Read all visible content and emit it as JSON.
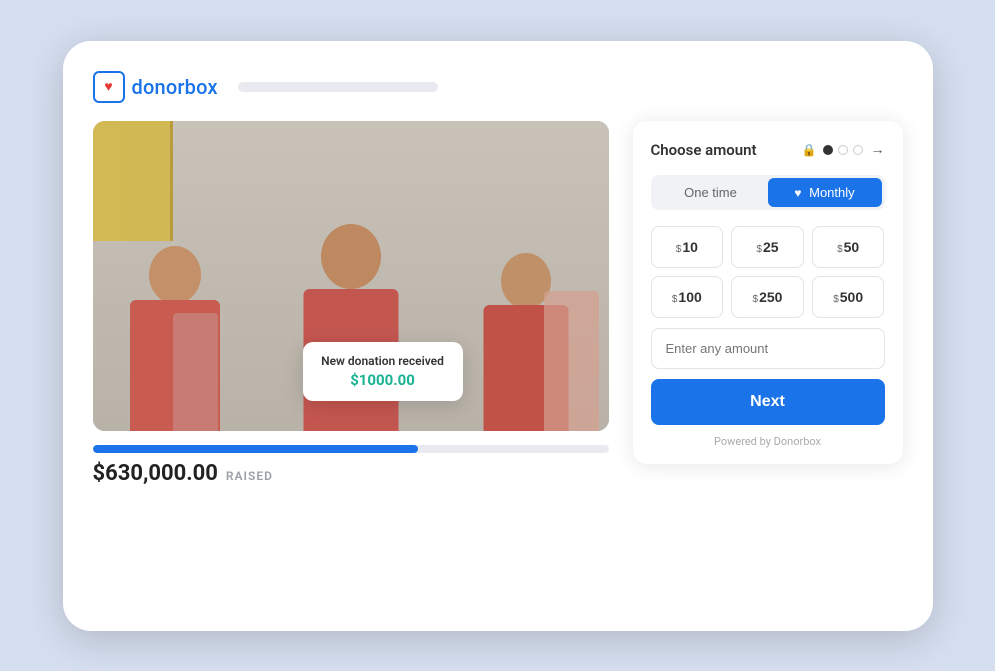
{
  "logo": {
    "text": "donorbox",
    "heart": "♥"
  },
  "header": {
    "placeholder_bar": ""
  },
  "donation_card": {
    "choose_amount_label": "Choose amount",
    "frequency_options": [
      {
        "label": "One time",
        "active": false
      },
      {
        "label": "Monthly",
        "active": true,
        "heart": "♥"
      }
    ],
    "amounts": [
      {
        "currency": "$",
        "value": "10"
      },
      {
        "currency": "$",
        "value": "25"
      },
      {
        "currency": "$",
        "value": "50"
      },
      {
        "currency": "$",
        "value": "100"
      },
      {
        "currency": "$",
        "value": "250"
      },
      {
        "currency": "$",
        "value": "500"
      }
    ],
    "custom_amount_placeholder": "Enter any amount",
    "next_button_label": "Next",
    "powered_by": "Powered by Donorbox"
  },
  "notification": {
    "title": "New donation received",
    "amount": "$1000.00"
  },
  "progress": {
    "raised_amount": "$630,000.00",
    "raised_label": "RAISED",
    "percent": 63
  },
  "steps": {
    "lock": "🔒",
    "dots": [
      "active",
      "empty",
      "empty"
    ],
    "arrow": "→"
  }
}
